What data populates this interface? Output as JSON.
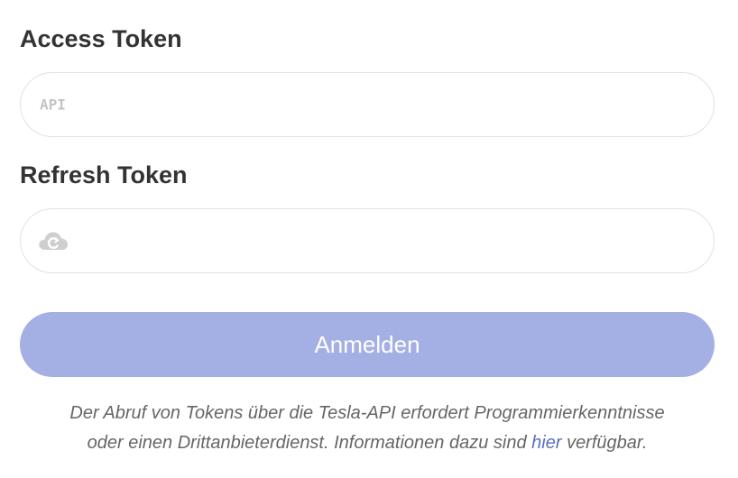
{
  "access_token": {
    "label": "Access Token",
    "icon": "api-icon",
    "icon_text": "API",
    "value": ""
  },
  "refresh_token": {
    "label": "Refresh Token",
    "icon": "cloud-refresh-icon",
    "value": ""
  },
  "submit": {
    "label": "Anmelden",
    "color": "#a4b0e4"
  },
  "note": {
    "line1": "Der Abruf von Tokens über die Tesla-API erfordert Programmierkenntnisse",
    "line2_prefix": "oder einen Drittanbieterdienst. Informationen dazu sind",
    "link_text": "hier",
    "line2_suffix": "verfügbar.",
    "link_color": "#5a6fc4"
  }
}
